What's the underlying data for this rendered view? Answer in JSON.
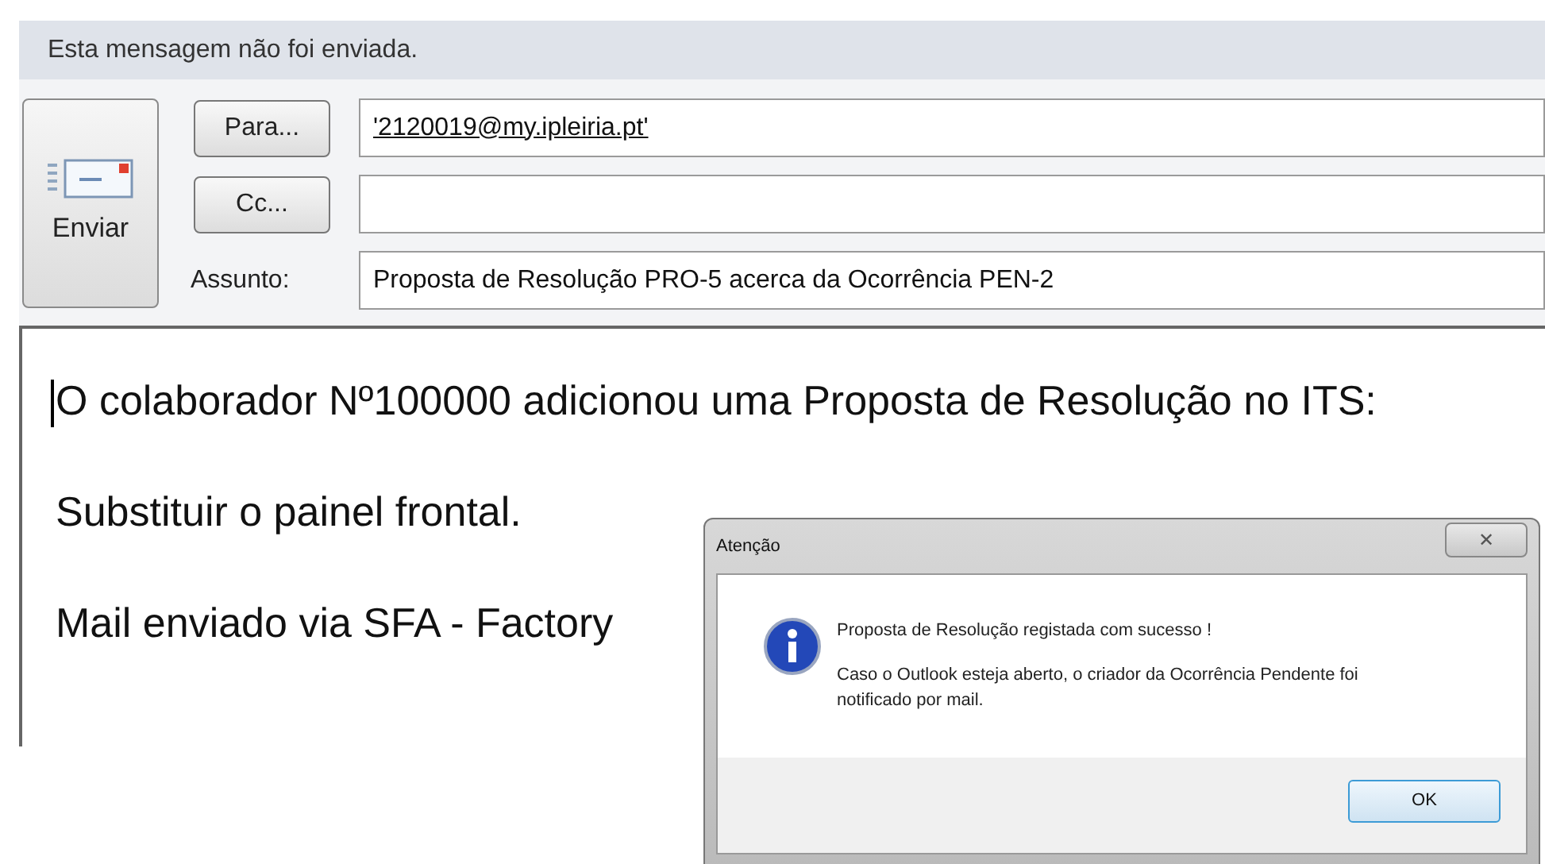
{
  "info_bar": {
    "text": "Esta mensagem não foi enviada."
  },
  "send_button": {
    "label": "Enviar"
  },
  "fields": [
    {
      "kind": "button",
      "label": "Para...",
      "value": "'2120019@my.ipleiria.pt'"
    },
    {
      "kind": "button",
      "label": "Cc..."
    },
    {
      "kind": "label",
      "label": "Assunto:",
      "value": "Proposta de Resolução PRO-5 acerca da Ocorrência PEN-2"
    }
  ],
  "body": {
    "paragraphs": [
      "O colaborador Nº100000 adicionou uma Proposta de Resolução no ITS:",
      "Substituir o painel frontal.",
      "Mail enviado via SFA - Factory"
    ]
  },
  "dialog": {
    "title": "Atenção",
    "close": "✕",
    "messages": [
      "Proposta de Resolução registada com sucesso !",
      "Caso o Outlook esteja aberto, o criador da Ocorrência Pendente foi notificado por mail."
    ],
    "button": "OK"
  }
}
